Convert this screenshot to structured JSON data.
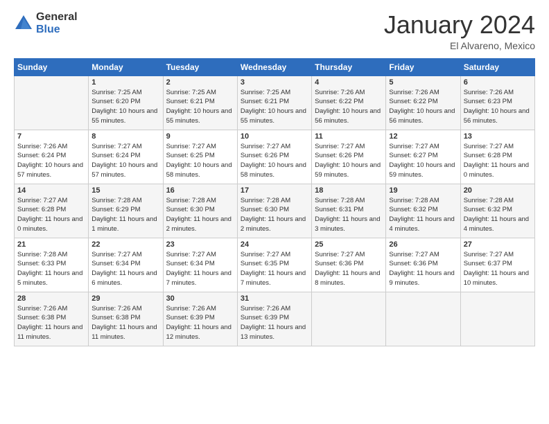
{
  "logo": {
    "general": "General",
    "blue": "Blue"
  },
  "title": "January 2024",
  "location": "El Alvareno, Mexico",
  "days_of_week": [
    "Sunday",
    "Monday",
    "Tuesday",
    "Wednesday",
    "Thursday",
    "Friday",
    "Saturday"
  ],
  "weeks": [
    [
      {
        "day": "",
        "sunrise": "",
        "sunset": "",
        "daylight": ""
      },
      {
        "day": "1",
        "sunrise": "Sunrise: 7:25 AM",
        "sunset": "Sunset: 6:20 PM",
        "daylight": "Daylight: 10 hours and 55 minutes."
      },
      {
        "day": "2",
        "sunrise": "Sunrise: 7:25 AM",
        "sunset": "Sunset: 6:21 PM",
        "daylight": "Daylight: 10 hours and 55 minutes."
      },
      {
        "day": "3",
        "sunrise": "Sunrise: 7:25 AM",
        "sunset": "Sunset: 6:21 PM",
        "daylight": "Daylight: 10 hours and 55 minutes."
      },
      {
        "day": "4",
        "sunrise": "Sunrise: 7:26 AM",
        "sunset": "Sunset: 6:22 PM",
        "daylight": "Daylight: 10 hours and 56 minutes."
      },
      {
        "day": "5",
        "sunrise": "Sunrise: 7:26 AM",
        "sunset": "Sunset: 6:22 PM",
        "daylight": "Daylight: 10 hours and 56 minutes."
      },
      {
        "day": "6",
        "sunrise": "Sunrise: 7:26 AM",
        "sunset": "Sunset: 6:23 PM",
        "daylight": "Daylight: 10 hours and 56 minutes."
      }
    ],
    [
      {
        "day": "7",
        "sunrise": "Sunrise: 7:26 AM",
        "sunset": "Sunset: 6:24 PM",
        "daylight": "Daylight: 10 hours and 57 minutes."
      },
      {
        "day": "8",
        "sunrise": "Sunrise: 7:27 AM",
        "sunset": "Sunset: 6:24 PM",
        "daylight": "Daylight: 10 hours and 57 minutes."
      },
      {
        "day": "9",
        "sunrise": "Sunrise: 7:27 AM",
        "sunset": "Sunset: 6:25 PM",
        "daylight": "Daylight: 10 hours and 58 minutes."
      },
      {
        "day": "10",
        "sunrise": "Sunrise: 7:27 AM",
        "sunset": "Sunset: 6:26 PM",
        "daylight": "Daylight: 10 hours and 58 minutes."
      },
      {
        "day": "11",
        "sunrise": "Sunrise: 7:27 AM",
        "sunset": "Sunset: 6:26 PM",
        "daylight": "Daylight: 10 hours and 59 minutes."
      },
      {
        "day": "12",
        "sunrise": "Sunrise: 7:27 AM",
        "sunset": "Sunset: 6:27 PM",
        "daylight": "Daylight: 10 hours and 59 minutes."
      },
      {
        "day": "13",
        "sunrise": "Sunrise: 7:27 AM",
        "sunset": "Sunset: 6:28 PM",
        "daylight": "Daylight: 11 hours and 0 minutes."
      }
    ],
    [
      {
        "day": "14",
        "sunrise": "Sunrise: 7:27 AM",
        "sunset": "Sunset: 6:28 PM",
        "daylight": "Daylight: 11 hours and 0 minutes."
      },
      {
        "day": "15",
        "sunrise": "Sunrise: 7:28 AM",
        "sunset": "Sunset: 6:29 PM",
        "daylight": "Daylight: 11 hours and 1 minute."
      },
      {
        "day": "16",
        "sunrise": "Sunrise: 7:28 AM",
        "sunset": "Sunset: 6:30 PM",
        "daylight": "Daylight: 11 hours and 2 minutes."
      },
      {
        "day": "17",
        "sunrise": "Sunrise: 7:28 AM",
        "sunset": "Sunset: 6:30 PM",
        "daylight": "Daylight: 11 hours and 2 minutes."
      },
      {
        "day": "18",
        "sunrise": "Sunrise: 7:28 AM",
        "sunset": "Sunset: 6:31 PM",
        "daylight": "Daylight: 11 hours and 3 minutes."
      },
      {
        "day": "19",
        "sunrise": "Sunrise: 7:28 AM",
        "sunset": "Sunset: 6:32 PM",
        "daylight": "Daylight: 11 hours and 4 minutes."
      },
      {
        "day": "20",
        "sunrise": "Sunrise: 7:28 AM",
        "sunset": "Sunset: 6:32 PM",
        "daylight": "Daylight: 11 hours and 4 minutes."
      }
    ],
    [
      {
        "day": "21",
        "sunrise": "Sunrise: 7:28 AM",
        "sunset": "Sunset: 6:33 PM",
        "daylight": "Daylight: 11 hours and 5 minutes."
      },
      {
        "day": "22",
        "sunrise": "Sunrise: 7:27 AM",
        "sunset": "Sunset: 6:34 PM",
        "daylight": "Daylight: 11 hours and 6 minutes."
      },
      {
        "day": "23",
        "sunrise": "Sunrise: 7:27 AM",
        "sunset": "Sunset: 6:34 PM",
        "daylight": "Daylight: 11 hours and 7 minutes."
      },
      {
        "day": "24",
        "sunrise": "Sunrise: 7:27 AM",
        "sunset": "Sunset: 6:35 PM",
        "daylight": "Daylight: 11 hours and 7 minutes."
      },
      {
        "day": "25",
        "sunrise": "Sunrise: 7:27 AM",
        "sunset": "Sunset: 6:36 PM",
        "daylight": "Daylight: 11 hours and 8 minutes."
      },
      {
        "day": "26",
        "sunrise": "Sunrise: 7:27 AM",
        "sunset": "Sunset: 6:36 PM",
        "daylight": "Daylight: 11 hours and 9 minutes."
      },
      {
        "day": "27",
        "sunrise": "Sunrise: 7:27 AM",
        "sunset": "Sunset: 6:37 PM",
        "daylight": "Daylight: 11 hours and 10 minutes."
      }
    ],
    [
      {
        "day": "28",
        "sunrise": "Sunrise: 7:26 AM",
        "sunset": "Sunset: 6:38 PM",
        "daylight": "Daylight: 11 hours and 11 minutes."
      },
      {
        "day": "29",
        "sunrise": "Sunrise: 7:26 AM",
        "sunset": "Sunset: 6:38 PM",
        "daylight": "Daylight: 11 hours and 11 minutes."
      },
      {
        "day": "30",
        "sunrise": "Sunrise: 7:26 AM",
        "sunset": "Sunset: 6:39 PM",
        "daylight": "Daylight: 11 hours and 12 minutes."
      },
      {
        "day": "31",
        "sunrise": "Sunrise: 7:26 AM",
        "sunset": "Sunset: 6:39 PM",
        "daylight": "Daylight: 11 hours and 13 minutes."
      },
      {
        "day": "",
        "sunrise": "",
        "sunset": "",
        "daylight": ""
      },
      {
        "day": "",
        "sunrise": "",
        "sunset": "",
        "daylight": ""
      },
      {
        "day": "",
        "sunrise": "",
        "sunset": "",
        "daylight": ""
      }
    ]
  ]
}
